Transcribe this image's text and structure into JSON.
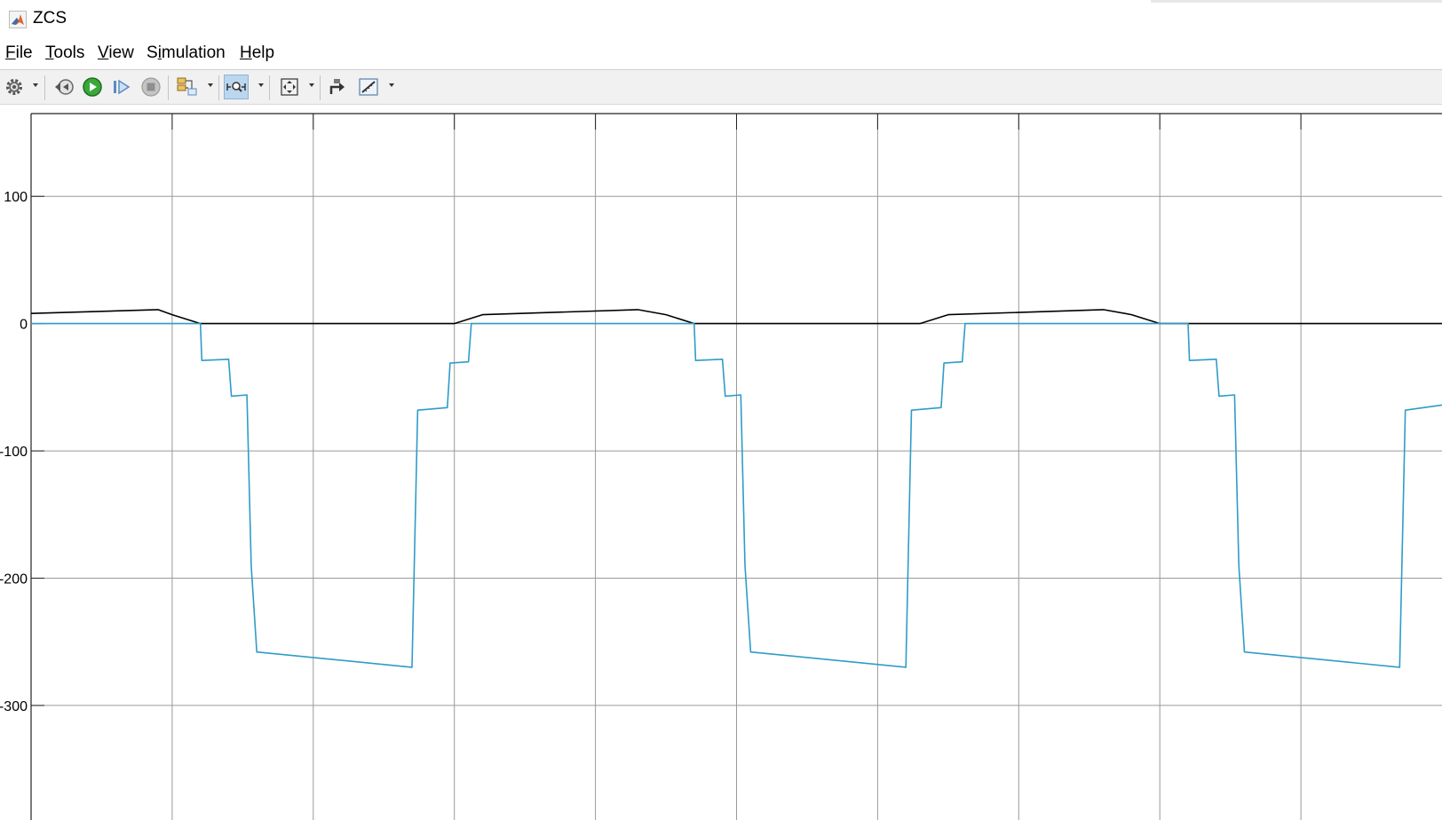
{
  "window": {
    "title": "ZCS"
  },
  "menu": [
    {
      "id": "file",
      "pre": "",
      "ul": "F",
      "post": "ile"
    },
    {
      "id": "tools",
      "pre": "",
      "ul": "T",
      "post": "ools"
    },
    {
      "id": "view",
      "pre": "",
      "ul": "V",
      "post": "iew"
    },
    {
      "id": "simulation",
      "pre": "S",
      "ul": "i",
      "post": "mulation"
    },
    {
      "id": "help",
      "pre": "",
      "ul": "H",
      "post": "elp"
    }
  ],
  "toolbar": {
    "buttons": [
      "gear-icon",
      "step-back-icon",
      "run-icon",
      "step-forward-icon",
      "stop-icon",
      "signal-selector-icon",
      "zoom-icon",
      "fit-to-view-icon",
      "highlight-model-icon",
      "measurement-tool-icon"
    ],
    "active": "zoom-icon"
  },
  "colors": {
    "series1": "#000000",
    "series2": "#2e9cc9",
    "grid": "#9a9a9a"
  },
  "chart_data": {
    "type": "line",
    "title": "",
    "xlabel": "",
    "ylabel": "",
    "ylim": [
      -390,
      165
    ],
    "xlim": [
      0,
      10
    ],
    "yticks": [
      100,
      0,
      -100,
      -200,
      -300
    ],
    "ytick_labels": [
      "100",
      "0",
      "-100",
      "-200",
      "-300"
    ],
    "x_gridlines": [
      1,
      2,
      3,
      4,
      5,
      6,
      7,
      8,
      9
    ],
    "grid": true,
    "series": [
      {
        "color": "#000000",
        "points": [
          [
            0,
            8
          ],
          [
            0.9,
            11
          ],
          [
            1.0,
            7
          ],
          [
            1.2,
            0
          ],
          [
            3.0,
            0
          ],
          [
            3.2,
            7
          ],
          [
            4.3,
            11
          ],
          [
            4.5,
            7
          ],
          [
            4.7,
            0
          ],
          [
            6.3,
            0
          ],
          [
            6.5,
            7
          ],
          [
            7.6,
            11
          ],
          [
            7.8,
            7
          ],
          [
            8.0,
            0
          ],
          [
            10.0,
            0
          ]
        ]
      },
      {
        "color": "#2e9cc9",
        "points": [
          [
            0,
            0
          ],
          [
            1.2,
            0
          ],
          [
            1.21,
            -29
          ],
          [
            1.4,
            -28
          ],
          [
            1.42,
            -57
          ],
          [
            1.53,
            -56
          ],
          [
            1.56,
            -190
          ],
          [
            1.6,
            -258
          ],
          [
            2.7,
            -270
          ],
          [
            2.74,
            -68
          ],
          [
            2.95,
            -66
          ],
          [
            2.97,
            -31
          ],
          [
            3.1,
            -30
          ],
          [
            3.12,
            0
          ],
          [
            4.7,
            0
          ],
          [
            4.71,
            -29
          ],
          [
            4.9,
            -28
          ],
          [
            4.92,
            -57
          ],
          [
            5.03,
            -56
          ],
          [
            5.06,
            -190
          ],
          [
            5.1,
            -258
          ],
          [
            6.2,
            -270
          ],
          [
            6.24,
            -68
          ],
          [
            6.45,
            -66
          ],
          [
            6.47,
            -31
          ],
          [
            6.6,
            -30
          ],
          [
            6.62,
            0
          ],
          [
            8.2,
            0
          ],
          [
            8.21,
            -29
          ],
          [
            8.4,
            -28
          ],
          [
            8.42,
            -57
          ],
          [
            8.53,
            -56
          ],
          [
            8.56,
            -190
          ],
          [
            8.6,
            -258
          ],
          [
            9.7,
            -270
          ],
          [
            9.74,
            -68
          ],
          [
            10.0,
            -64
          ]
        ]
      }
    ]
  }
}
